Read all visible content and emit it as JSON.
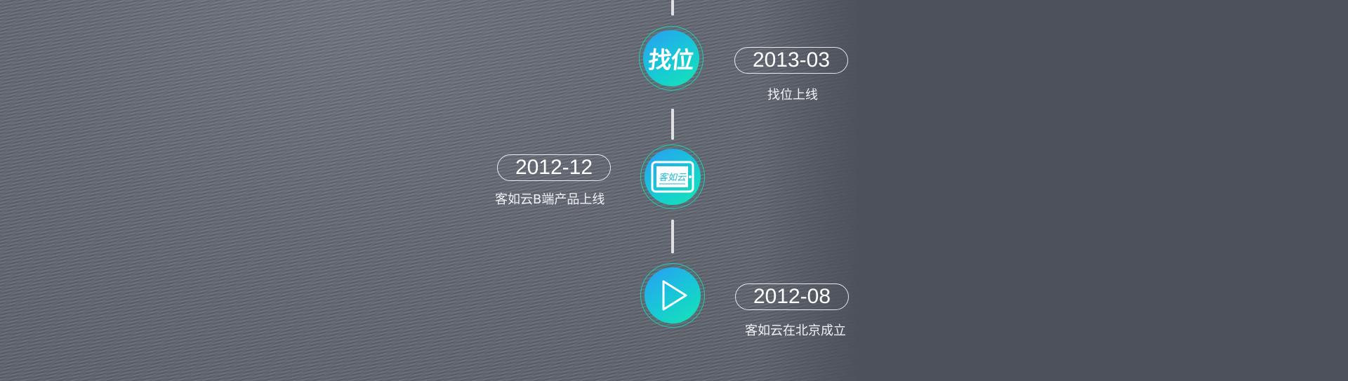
{
  "timeline": {
    "events": [
      {
        "date": "2013-03",
        "caption": "找位上线",
        "icon": "zhaowei-logo-icon",
        "icon_text": "找位"
      },
      {
        "date": "2012-12",
        "caption": "客如云B端产品上线",
        "icon": "keruyun-tablet-icon",
        "icon_text": "客如云"
      },
      {
        "date": "2012-08",
        "caption": "客如云在北京成立",
        "icon": "play-icon"
      }
    ]
  },
  "colors": {
    "node_gradient_start": "#2a9df5",
    "node_gradient_end": "#14e6b4",
    "ring": "#1ddcbe",
    "line": "#dfe1e5",
    "text": "#ffffff",
    "background_dark": "#4c515b"
  }
}
